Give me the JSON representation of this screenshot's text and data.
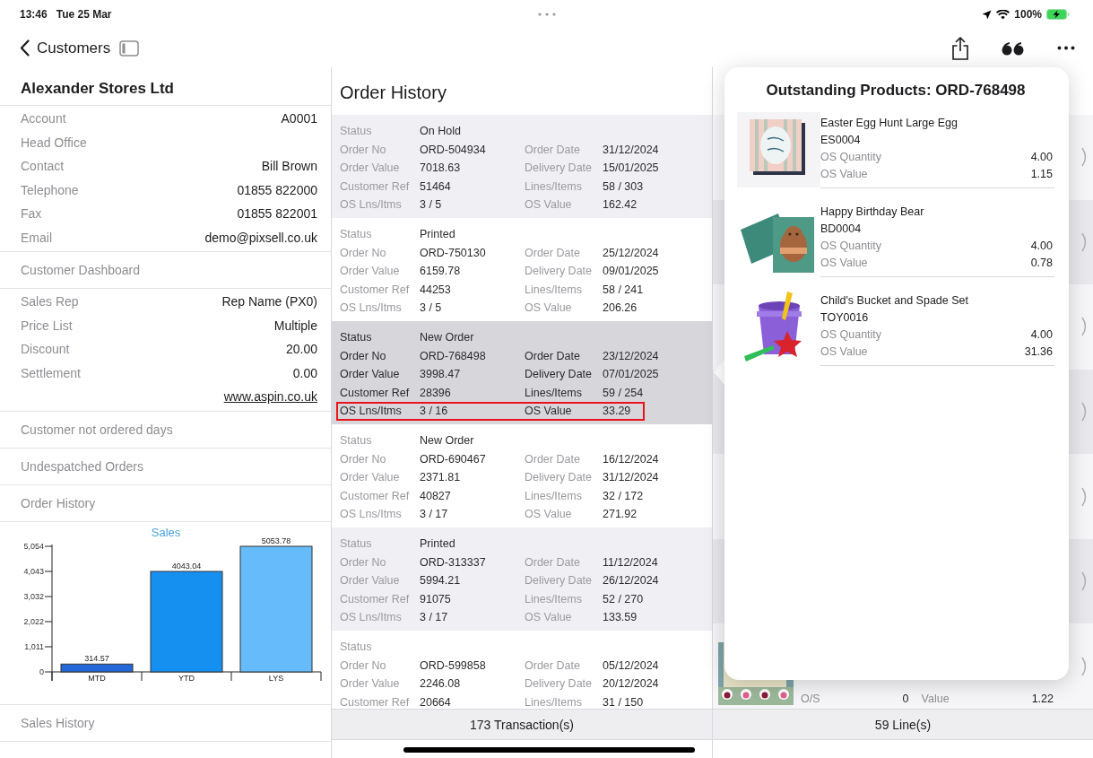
{
  "status_bar": {
    "time": "13:46",
    "date": "Tue 25 Mar",
    "battery": "100%"
  },
  "nav": {
    "back_label": "Customers"
  },
  "left_panel": {
    "blocks": [
      {
        "kind": "title",
        "text": "Alexander Stores Ltd"
      },
      {
        "kind": "fields",
        "rows": [
          {
            "kind": "field",
            "label": "Account",
            "value": "A0001"
          },
          {
            "kind": "field",
            "label": "Head Office"
          },
          {
            "kind": "field",
            "label": "Contact",
            "value": "Bill Brown"
          },
          {
            "kind": "field",
            "label": "Telephone",
            "value": "01855 822000"
          },
          {
            "kind": "field",
            "label": "Fax",
            "value": "01855 822001"
          },
          {
            "kind": "field",
            "label": "Email",
            "value": "demo@pixsell.co.uk"
          }
        ]
      },
      {
        "kind": "section",
        "label": "Customer Dashboard"
      },
      {
        "kind": "fields",
        "rows": [
          {
            "kind": "field",
            "label": "Sales Rep",
            "value": "Rep Name (PX0)"
          },
          {
            "kind": "field",
            "label": "Price List",
            "value": "Multiple"
          },
          {
            "kind": "field",
            "label": "Discount",
            "value": "20.00"
          },
          {
            "kind": "field",
            "label": "Settlement",
            "value": "0.00"
          },
          {
            "kind": "link",
            "text": "www.aspin.co.uk"
          }
        ]
      },
      {
        "kind": "section",
        "label": "Customer not ordered days"
      },
      {
        "kind": "section",
        "label": "Undespatched Orders"
      },
      {
        "kind": "section",
        "label": "Order History"
      },
      {
        "kind": "chart",
        "chart_data": {
          "type": "bar",
          "title": "Sales",
          "categories": [
            "MTD",
            "YTD",
            "LYS"
          ],
          "values": [
            314.57,
            4043.04,
            5053.78
          ],
          "ylim": [
            0,
            5054
          ],
          "yticks": [
            0,
            {
              "value": 1011,
              "label": "1,011"
            },
            {
              "value": 2022,
              "label": "2,022"
            },
            {
              "value": 3032,
              "label": "3,032"
            },
            {
              "value": 4043,
              "label": "4,043"
            },
            {
              "value": 5054,
              "label": "5,054"
            }
          ],
          "data_labels": true
        }
      },
      {
        "kind": "section",
        "label": "Sales History"
      }
    ]
  },
  "order_history": {
    "title": "Order History",
    "footer": "173 Transaction(s)",
    "cards": [
      {
        "selected": false,
        "outlined_row": false,
        "rows": [
          [
            {
              "label": "Status",
              "value": "On Hold"
            }
          ],
          [
            {
              "label": "Order No",
              "value": "ORD-504934"
            },
            {
              "label": "Order Date",
              "value": "31/12/2024"
            }
          ],
          [
            {
              "label": "Order Value",
              "value": "7018.63"
            },
            {
              "label": "Delivery Date",
              "value": "15/01/2025"
            }
          ],
          [
            {
              "label": "Customer Ref",
              "value": "51464"
            },
            {
              "label": "Lines/Items",
              "value": "58 / 303"
            }
          ],
          [
            {
              "label": "OS Lns/Itms",
              "value": "3 / 5"
            },
            {
              "label": "OS Value",
              "value": "162.42"
            }
          ]
        ]
      },
      {
        "selected": false,
        "outlined_row": false,
        "rows": [
          [
            {
              "label": "Status",
              "value": "Printed"
            }
          ],
          [
            {
              "label": "Order No",
              "value": "ORD-750130"
            },
            {
              "label": "Order Date",
              "value": "25/12/2024"
            }
          ],
          [
            {
              "label": "Order Value",
              "value": "6159.78"
            },
            {
              "label": "Delivery Date",
              "value": "09/01/2025"
            }
          ],
          [
            {
              "label": "Customer Ref",
              "value": "44253"
            },
            {
              "label": "Lines/Items",
              "value": "58 / 241"
            }
          ],
          [
            {
              "label": "OS Lns/Itms",
              "value": "3 / 5"
            },
            {
              "label": "OS Value",
              "value": "206.26"
            }
          ]
        ]
      },
      {
        "selected": true,
        "outlined_row": true,
        "rows": [
          [
            {
              "label": "Status",
              "value": "New Order"
            }
          ],
          [
            {
              "label": "Order No",
              "value": "ORD-768498"
            },
            {
              "label": "Order Date",
              "value": "23/12/2024"
            }
          ],
          [
            {
              "label": "Order Value",
              "value": "3998.47"
            },
            {
              "label": "Delivery Date",
              "value": "07/01/2025"
            }
          ],
          [
            {
              "label": "Customer Ref",
              "value": "28396"
            },
            {
              "label": "Lines/Items",
              "value": "59 / 254"
            }
          ],
          [
            {
              "label": "OS Lns/Itms",
              "value": "3 / 16"
            },
            {
              "label": "OS Value",
              "value": "33.29"
            }
          ]
        ]
      },
      {
        "selected": false,
        "outlined_row": false,
        "rows": [
          [
            {
              "label": "Status",
              "value": "New Order"
            }
          ],
          [
            {
              "label": "Order No",
              "value": "ORD-690467"
            },
            {
              "label": "Order Date",
              "value": "16/12/2024"
            }
          ],
          [
            {
              "label": "Order Value",
              "value": "2371.81"
            },
            {
              "label": "Delivery Date",
              "value": "31/12/2024"
            }
          ],
          [
            {
              "label": "Customer Ref",
              "value": "40827"
            },
            {
              "label": "Lines/Items",
              "value": "32 / 172"
            }
          ],
          [
            {
              "label": "OS Lns/Itms",
              "value": "3 / 17"
            },
            {
              "label": "OS Value",
              "value": "271.92"
            }
          ]
        ]
      },
      {
        "selected": false,
        "outlined_row": false,
        "rows": [
          [
            {
              "label": "Status",
              "value": "Printed"
            }
          ],
          [
            {
              "label": "Order No",
              "value": "ORD-313337"
            },
            {
              "label": "Order Date",
              "value": "11/12/2024"
            }
          ],
          [
            {
              "label": "Order Value",
              "value": "5994.21"
            },
            {
              "label": "Delivery Date",
              "value": "26/12/2024"
            }
          ],
          [
            {
              "label": "Customer Ref",
              "value": "91075"
            },
            {
              "label": "Lines/Items",
              "value": "52 / 270"
            }
          ],
          [
            {
              "label": "OS Lns/Itms",
              "value": "3 / 17"
            },
            {
              "label": "OS Value",
              "value": "133.59"
            }
          ]
        ]
      },
      {
        "selected": false,
        "outlined_row": false,
        "rows": [
          [
            {
              "label": "Status"
            }
          ],
          [
            {
              "label": "Order No",
              "value": "ORD-599858"
            },
            {
              "label": "Order Date",
              "value": "05/12/2024"
            }
          ],
          [
            {
              "label": "Order Value",
              "value": "2246.08"
            },
            {
              "label": "Delivery Date",
              "value": "20/12/2024"
            }
          ],
          [
            {
              "label": "Customer Ref",
              "value": "20664"
            },
            {
              "label": "Lines/Items",
              "value": "31 / 150"
            }
          ]
        ]
      }
    ]
  },
  "lines_panel": {
    "footer": "59 Line(s)",
    "rows": [
      {
        "kind": "covered"
      },
      {
        "kind": "covered"
      },
      {
        "kind": "covered"
      },
      {
        "kind": "covered"
      },
      {
        "kind": "covered"
      },
      {
        "kind": "covered"
      },
      {
        "kind": "line",
        "os_label": "O/S",
        "os_value": "0",
        "value_label": "Value",
        "value": "1.22"
      }
    ]
  },
  "popover": {
    "title": "Outstanding Products: ORD-768498",
    "products": [
      {
        "name": "Easter Egg Hunt Large Egg",
        "code": "ES0004",
        "fields": [
          {
            "label": "OS Quantity",
            "value": "4.00"
          },
          {
            "label": "OS Value",
            "value": "1.15"
          }
        ]
      },
      {
        "name": "Happy Birthday Bear",
        "code": "BD0004",
        "fields": [
          {
            "label": "OS Quantity",
            "value": "4.00"
          },
          {
            "label": "OS Value",
            "value": "0.78"
          }
        ]
      },
      {
        "name": "Child's Bucket and Spade Set",
        "code": "TOY0016",
        "fields": [
          {
            "label": "OS Quantity",
            "value": "4.00"
          },
          {
            "label": "OS Value",
            "value": "31.36"
          }
        ]
      }
    ]
  }
}
